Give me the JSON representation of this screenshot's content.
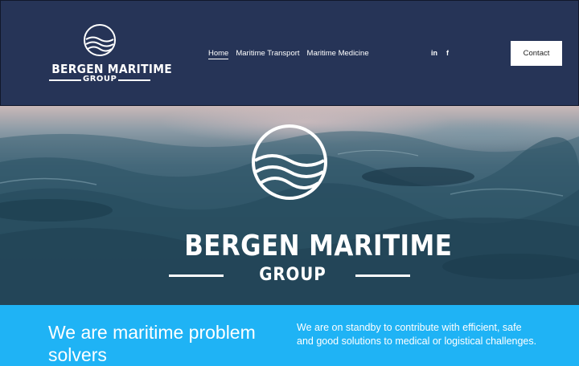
{
  "brand": {
    "name_line1": "BERGEN MARITIME",
    "name_line2": "GROUP"
  },
  "nav": {
    "items": [
      {
        "label": "Home",
        "active": true
      },
      {
        "label": "Maritime Transport",
        "active": false
      },
      {
        "label": "Maritime Medicine",
        "active": false
      }
    ]
  },
  "social": {
    "linkedin": "in",
    "facebook": "f"
  },
  "header": {
    "contact_label": "Contact"
  },
  "hero": {
    "title_line1": "BERGEN MARITIME",
    "title_line2": "GROUP"
  },
  "intro": {
    "headline": "We are maritime problem solvers",
    "description": "We are on standby to contribute with efficient, safe and good solutions to medical or logistical challenges."
  },
  "colors": {
    "header_bg": "#263457",
    "accent_blue": "#1fb3f5",
    "text": "#ffffff"
  }
}
